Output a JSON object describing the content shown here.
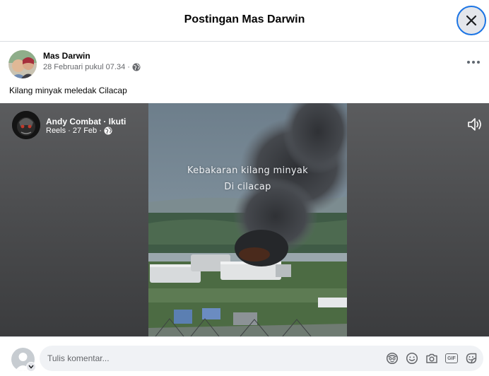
{
  "header": {
    "title": "Postingan Mas Darwin",
    "close_icon": "close-icon"
  },
  "post": {
    "author": "Mas Darwin",
    "date": "28 Februari pukul 07.34 ·",
    "privacy_icon": "globe-icon",
    "more_icon": "more-horizontal-icon",
    "caption": "Kilang minyak meledak Cilacap"
  },
  "reel": {
    "author": "Andy Combat · Ikuti",
    "meta": "Reels · 27 Feb ·",
    "privacy_icon": "globe-icon",
    "volume_icon": "volume-icon",
    "overlay_line1": "Kebakaran kilang minyak",
    "overlay_line2": "Di cilacap"
  },
  "comment": {
    "placeholder": "Tulis komentar...",
    "gif_label": "GIF",
    "icons": [
      "avatar-sticker-icon",
      "emoji-icon",
      "camera-icon",
      "gif-icon",
      "sticker-icon"
    ]
  },
  "colors": {
    "accent": "#1b74e4",
    "text_primary": "#050505",
    "text_secondary": "#65676b",
    "input_bg": "#f0f2f5"
  }
}
